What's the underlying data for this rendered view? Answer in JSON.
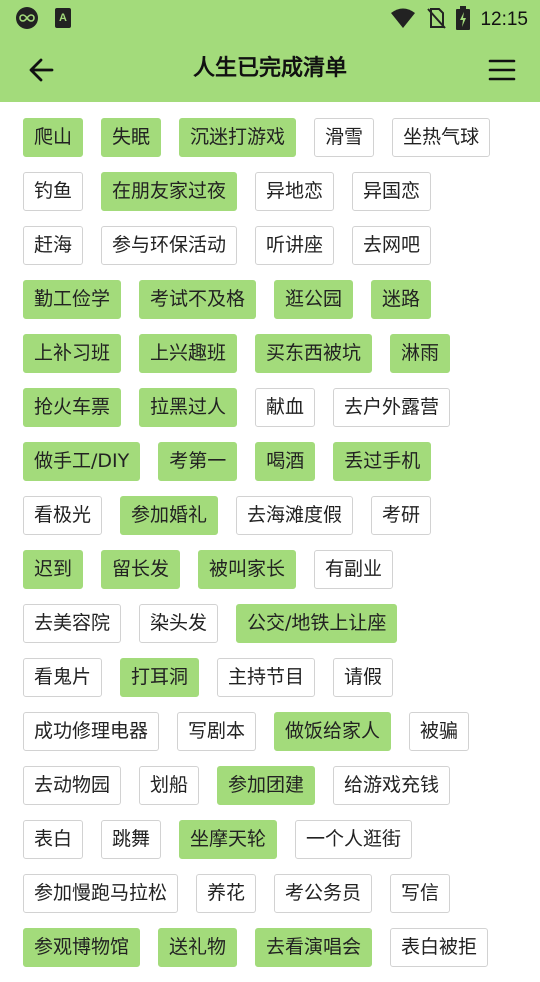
{
  "status_bar": {
    "time": "12:15"
  },
  "header": {
    "title": "人生已完成清单"
  },
  "colors": {
    "accent": "#a3db7b",
    "tag_border": "#d2d2d2"
  },
  "tag_rows": [
    [
      {
        "label": "爬山",
        "done": true
      },
      {
        "label": "失眠",
        "done": true
      },
      {
        "label": "沉迷打游戏",
        "done": true
      },
      {
        "label": "滑雪",
        "done": false
      },
      {
        "label": "坐热气球",
        "done": false
      }
    ],
    [
      {
        "label": "钓鱼",
        "done": false
      },
      {
        "label": "在朋友家过夜",
        "done": true
      },
      {
        "label": "异地恋",
        "done": false
      },
      {
        "label": "异国恋",
        "done": false
      }
    ],
    [
      {
        "label": "赶海",
        "done": false
      },
      {
        "label": "参与环保活动",
        "done": false
      },
      {
        "label": "听讲座",
        "done": false
      },
      {
        "label": "去网吧",
        "done": false
      }
    ],
    [
      {
        "label": "勤工俭学",
        "done": true
      },
      {
        "label": "考试不及格",
        "done": true
      },
      {
        "label": "逛公园",
        "done": true
      },
      {
        "label": "迷路",
        "done": true
      }
    ],
    [
      {
        "label": "上补习班",
        "done": true
      },
      {
        "label": "上兴趣班",
        "done": true
      },
      {
        "label": "买东西被坑",
        "done": true
      },
      {
        "label": "淋雨",
        "done": true
      }
    ],
    [
      {
        "label": "抢火车票",
        "done": true
      },
      {
        "label": "拉黑过人",
        "done": true
      },
      {
        "label": "献血",
        "done": false
      },
      {
        "label": "去户外露营",
        "done": false
      }
    ],
    [
      {
        "label": "做手工/DIY",
        "done": true
      },
      {
        "label": "考第一",
        "done": true
      },
      {
        "label": "喝酒",
        "done": true
      },
      {
        "label": "丢过手机",
        "done": true
      }
    ],
    [
      {
        "label": "看极光",
        "done": false
      },
      {
        "label": "参加婚礼",
        "done": true
      },
      {
        "label": "去海滩度假",
        "done": false
      },
      {
        "label": "考研",
        "done": false
      }
    ],
    [
      {
        "label": "迟到",
        "done": true
      },
      {
        "label": "留长发",
        "done": true
      },
      {
        "label": "被叫家长",
        "done": true
      },
      {
        "label": "有副业",
        "done": false
      }
    ],
    [
      {
        "label": "去美容院",
        "done": false
      },
      {
        "label": "染头发",
        "done": false
      },
      {
        "label": "公交/地铁上让座",
        "done": true
      }
    ],
    [
      {
        "label": "看鬼片",
        "done": false
      },
      {
        "label": "打耳洞",
        "done": true
      },
      {
        "label": "主持节目",
        "done": false
      },
      {
        "label": "请假",
        "done": false
      }
    ],
    [
      {
        "label": "成功修理电器",
        "done": false
      },
      {
        "label": "写剧本",
        "done": false
      },
      {
        "label": "做饭给家人",
        "done": true
      },
      {
        "label": "被骗",
        "done": false
      }
    ],
    [
      {
        "label": "去动物园",
        "done": false
      },
      {
        "label": "划船",
        "done": false
      },
      {
        "label": "参加团建",
        "done": true
      },
      {
        "label": "给游戏充钱",
        "done": false
      }
    ],
    [
      {
        "label": "表白",
        "done": false
      },
      {
        "label": "跳舞",
        "done": false
      },
      {
        "label": "坐摩天轮",
        "done": true
      },
      {
        "label": "一个人逛街",
        "done": false
      }
    ],
    [
      {
        "label": "参加慢跑马拉松",
        "done": false
      },
      {
        "label": "养花",
        "done": false
      },
      {
        "label": "考公务员",
        "done": false
      },
      {
        "label": "写信",
        "done": false
      }
    ],
    [
      {
        "label": "参观博物馆",
        "done": true
      },
      {
        "label": "送礼物",
        "done": true
      },
      {
        "label": "去看演唱会",
        "done": true
      },
      {
        "label": "表白被拒",
        "done": false
      }
    ]
  ]
}
